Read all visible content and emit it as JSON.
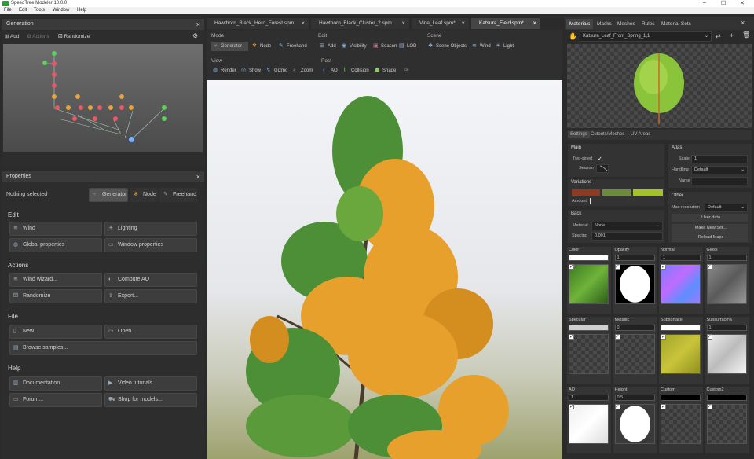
{
  "window": {
    "title": "SpeedTree Modeler 10.0.0",
    "controls": [
      "–",
      "☐",
      "✕"
    ]
  },
  "menu": [
    "File",
    "Edit",
    "Tools",
    "Window",
    "Help"
  ],
  "generation": {
    "title": "Generation",
    "add": "Add",
    "actions": "Actions",
    "randomize": "Randomize",
    "stats": [
      "2",
      "0",
      "0",
      "3",
      "0"
    ]
  },
  "properties": {
    "title": "Properties",
    "nothing": "Nothing selected",
    "modes": [
      "Generator",
      "Node",
      "Freehand"
    ],
    "edit_title": "Edit",
    "edit": [
      "Wind",
      "Lighting",
      "Global properties",
      "Window properties"
    ],
    "actions_title": "Actions",
    "actions": [
      "Wind wizard...",
      "Compute AO",
      "Randomize",
      "Export..."
    ],
    "file_title": "File",
    "file": [
      "New...",
      "Open...",
      "Browse samples..."
    ],
    "help_title": "Help",
    "help": [
      "Documentation...",
      "Video tutorials...",
      "Forum...",
      "Shop for models..."
    ]
  },
  "tabs": [
    "Hawthorn_Black_Hero_Forest.spm",
    "Hawthorn_Black_Cluster_2.spm",
    "Vine_Leaf.spm*",
    "Katsura_Field.spm*"
  ],
  "toolbar": {
    "mode_label": "Mode",
    "modes": [
      "Generator",
      "Node",
      "Freehand"
    ],
    "edit_label": "Edit",
    "edit": [
      "Add",
      "Visibility",
      "Season",
      "LOD"
    ],
    "scene_label": "Scene",
    "scene": [
      "Scene Objects",
      "Wind",
      "Light"
    ],
    "view_label": "View",
    "view": [
      "Render",
      "Show",
      "Gizmo",
      "Zoom"
    ],
    "post_label": "Post",
    "post": [
      "AO",
      "Collision",
      "Shade"
    ]
  },
  "materials": {
    "tabs": [
      "Materials",
      "Masks",
      "Meshes",
      "Rules",
      "Material Sets"
    ],
    "selected": "Katsura_Leaf_Front_Spring_1,1",
    "subtabs": [
      "Settings",
      "Cutouts/Meshes",
      "UV Areas"
    ],
    "main_label": "Main",
    "two_sided": "Two-sided",
    "two_sided_check": "✓",
    "season": "Season",
    "variations_label": "Variations",
    "amount": "Amount",
    "back_label": "Back",
    "back_material_label": "Material",
    "back_material": "None",
    "spacing_label": "Spacing",
    "spacing": "0.001",
    "atlas_label": "Atlas",
    "scale_label": "Scale",
    "scale": "1",
    "handling_label": "Handling",
    "handling": "Default",
    "name_label": "Name",
    "other_label": "Other",
    "maxres_label": "Max resolution",
    "maxres": "Default",
    "user_data": "User data",
    "make_new_set": "Make New Set...",
    "reload_maps": "Reload Maps",
    "variation_colors": [
      "#8a3b24",
      "#6d8b3e",
      "#a3c22c"
    ],
    "maps": [
      {
        "name": "Color",
        "value": "",
        "swatch": "#ffffff"
      },
      {
        "name": "Opacity",
        "value": "1",
        "swatch": ""
      },
      {
        "name": "Normal",
        "value": "1",
        "swatch": ""
      },
      {
        "name": "Gloss",
        "value": "1",
        "swatch": ""
      },
      {
        "name": "Specular",
        "value": "",
        "swatch": "#d0d0d0"
      },
      {
        "name": "Metallic",
        "value": "0",
        "swatch": ""
      },
      {
        "name": "Subsurface",
        "value": "",
        "swatch": "#ffffff"
      },
      {
        "name": "Subsurface%",
        "value": "1",
        "swatch": ""
      },
      {
        "name": "AO",
        "value": "1",
        "swatch": ""
      },
      {
        "name": "Height",
        "value": "0.5",
        "swatch": ""
      },
      {
        "name": "Custom",
        "value": "",
        "swatch": "#000000"
      },
      {
        "name": "Custom2",
        "value": "",
        "swatch": "#000000"
      }
    ]
  }
}
